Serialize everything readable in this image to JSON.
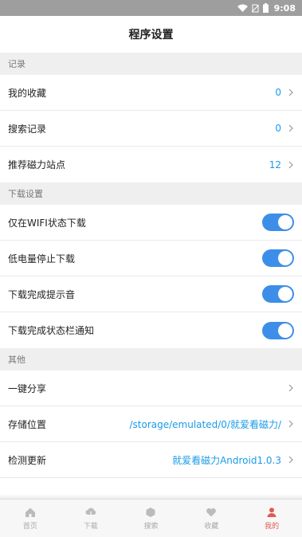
{
  "status_bar": {
    "time": "9:08"
  },
  "header": {
    "title": "程序设置"
  },
  "sections": {
    "records": {
      "title": "记录",
      "items": [
        {
          "label": "我的收藏",
          "value": "0"
        },
        {
          "label": "搜索记录",
          "value": "0"
        },
        {
          "label": "推荐磁力站点",
          "value": "12"
        }
      ]
    },
    "download": {
      "title": "下载设置",
      "items": [
        {
          "label": "仅在WIFI状态下载",
          "on": true
        },
        {
          "label": "低电量停止下载",
          "on": true
        },
        {
          "label": "下载完成提示音",
          "on": true
        },
        {
          "label": "下载完成状态栏通知",
          "on": true
        }
      ]
    },
    "other": {
      "title": "其他",
      "items": [
        {
          "label": "一键分享",
          "value": ""
        },
        {
          "label": "存储位置",
          "value": "/storage/emulated/0/就爱看磁力/"
        },
        {
          "label": "检测更新",
          "value": "就爱看磁力Android1.0.3"
        }
      ]
    }
  },
  "tabbar": {
    "active_color": "#e05a50",
    "tabs": [
      {
        "label": "首页",
        "icon": "home-icon"
      },
      {
        "label": "下载",
        "icon": "cloud-download-icon"
      },
      {
        "label": "搜索",
        "icon": "hexagon-icon"
      },
      {
        "label": "收藏",
        "icon": "heart-icon"
      },
      {
        "label": "我的",
        "icon": "person-icon"
      }
    ]
  }
}
